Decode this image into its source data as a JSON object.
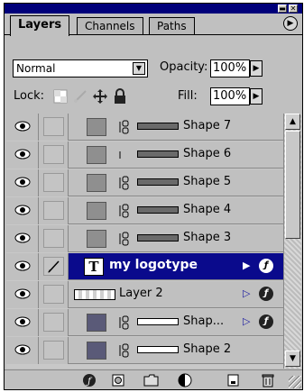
{
  "panel": {
    "tabs": [
      {
        "label": "Layers",
        "active": true
      },
      {
        "label": "Channels",
        "active": false
      },
      {
        "label": "Paths",
        "active": false
      }
    ],
    "menu_icon": "panel-menu-arrow-icon"
  },
  "controls": {
    "blend_mode": "Normal",
    "opacity_label": "Opacity:",
    "opacity_value": "100%",
    "lock_label": "Lock:",
    "fill_label": "Fill:",
    "fill_value": "100%"
  },
  "layers": [
    {
      "name": "Shape 7",
      "kind": "shape",
      "linked": true
    },
    {
      "name": "Shape 6",
      "kind": "shape",
      "linked": false
    },
    {
      "name": "Shape 5",
      "kind": "shape",
      "linked": true
    },
    {
      "name": "Shape 4",
      "kind": "shape",
      "linked": true
    },
    {
      "name": "Shape 3",
      "kind": "shape",
      "linked": true
    },
    {
      "name": "my logotype",
      "kind": "type",
      "selected": true,
      "type_icon_label": "T"
    },
    {
      "name": "Layer 2",
      "kind": "raster"
    },
    {
      "name": "Shap...",
      "kind": "shape",
      "linked": true
    },
    {
      "name": "Shape 2",
      "kind": "shape",
      "linked": true
    }
  ],
  "colors": {
    "title_bar": "#00007a",
    "selection": "#0a0a8c",
    "panel": "#c0c0c0"
  },
  "bottom_icons": [
    "layer-style-icon",
    "add-mask-icon",
    "new-set-icon",
    "new-adjustment-layer-icon",
    "new-layer-icon",
    "trash-icon"
  ]
}
